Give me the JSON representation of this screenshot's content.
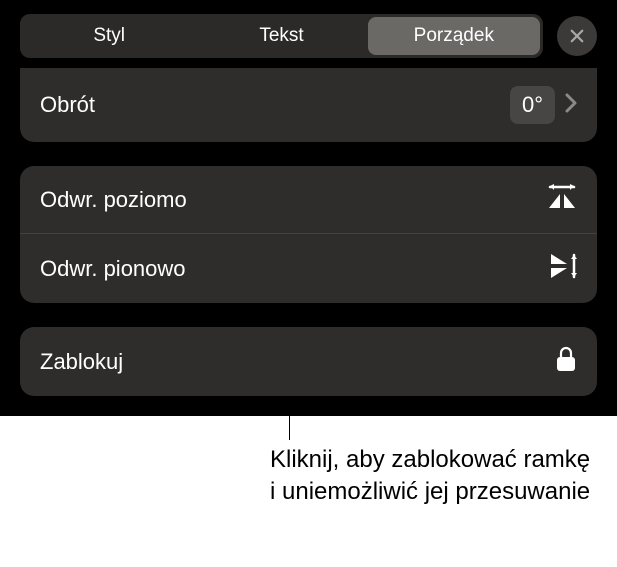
{
  "tabs": {
    "style": "Styl",
    "text": "Tekst",
    "arrangement": "Porządek"
  },
  "rotation": {
    "label": "Obrót",
    "value": "0°"
  },
  "flip": {
    "horizontal": "Odwr. poziomo",
    "vertical": "Odwr. pionowo"
  },
  "lock": {
    "label": "Zablokuj"
  },
  "annotation": "Kliknij, aby zablokować ramkę i uniemożliwić jej przesuwanie"
}
